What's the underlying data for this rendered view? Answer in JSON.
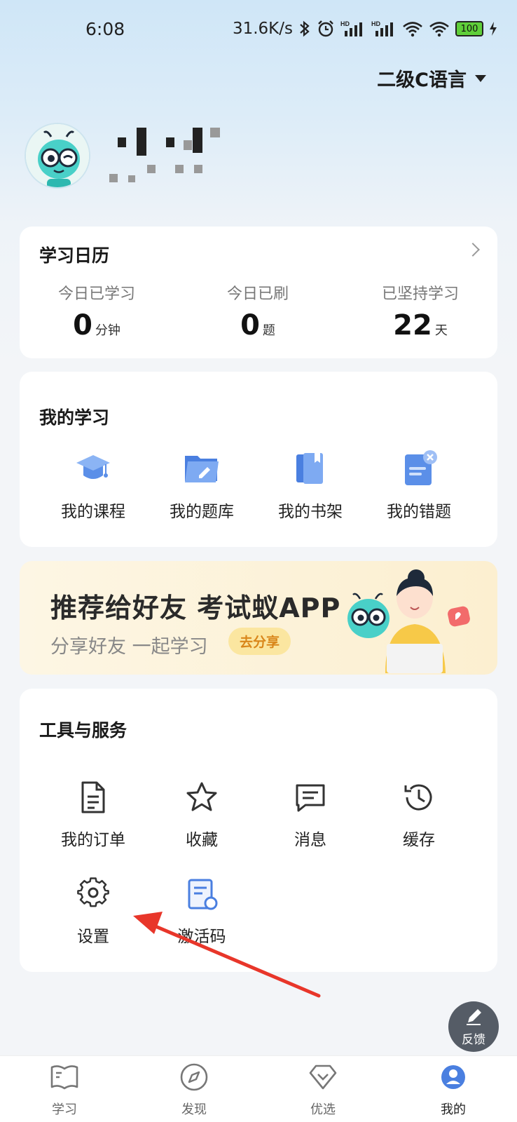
{
  "status_bar": {
    "time": "6:08",
    "network_speed": "31.6K/s",
    "battery": "100"
  },
  "header": {
    "exam_selector": "二级C语言"
  },
  "calendar_card": {
    "title": "学习日历",
    "stats": [
      {
        "label": "今日已学习",
        "value": "0",
        "unit": "分钟"
      },
      {
        "label": "今日已刷",
        "value": "0",
        "unit": "题"
      },
      {
        "label": "已坚持学习",
        "value": "22",
        "unit": "天"
      }
    ]
  },
  "my_study": {
    "title": "我的学习",
    "items": [
      {
        "label": "我的课程",
        "icon": "graduation-cap-icon"
      },
      {
        "label": "我的题库",
        "icon": "question-bank-icon"
      },
      {
        "label": "我的书架",
        "icon": "bookshelf-icon"
      },
      {
        "label": "我的错题",
        "icon": "wrong-questions-icon"
      }
    ]
  },
  "banner": {
    "title": "推荐给好友 考试蚁APP",
    "subtitle": "分享好友 一起学习",
    "button": "去分享"
  },
  "tools": {
    "title": "工具与服务",
    "items": [
      {
        "label": "我的订单",
        "icon": "order-document-icon"
      },
      {
        "label": "收藏",
        "icon": "star-icon"
      },
      {
        "label": "消息",
        "icon": "message-icon"
      },
      {
        "label": "缓存",
        "icon": "history-clock-icon"
      },
      {
        "label": "设置",
        "icon": "gear-icon"
      },
      {
        "label": "激活码",
        "icon": "activation-code-icon"
      }
    ]
  },
  "feedback": {
    "label": "反馈"
  },
  "tabbar": {
    "tabs": [
      {
        "label": "学习",
        "icon": "book-icon"
      },
      {
        "label": "发现",
        "icon": "compass-icon"
      },
      {
        "label": "优选",
        "icon": "diamond-icon"
      },
      {
        "label": "我的",
        "icon": "profile-icon",
        "active": true
      }
    ]
  },
  "colors": {
    "accent_blue": "#4a7fe0",
    "annotation_red": "#e8362a",
    "banner_button_text": "#d9861a"
  }
}
